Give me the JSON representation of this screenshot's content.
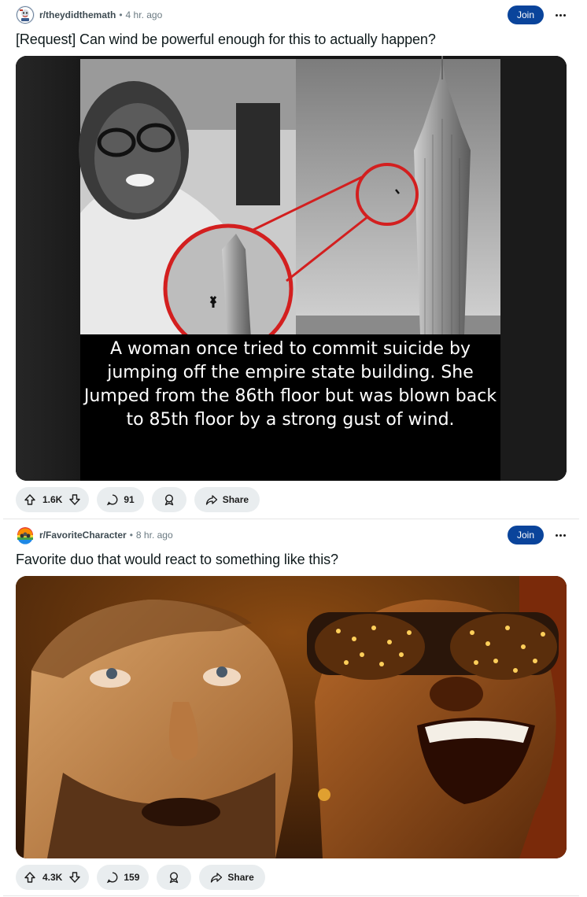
{
  "posts": [
    {
      "subreddit": "r/theydidthemath",
      "separator": "•",
      "time": "4 hr. ago",
      "join_label": "Join",
      "title": "[Request] Can wind be powerful enough for this to actually happen?",
      "image_caption": "A woman once tried to commit suicide by jumping off the empire state building. She Jumped from the 86th floor but was blown back to 85th floor by a strong gust of wind.",
      "votes": "1.6K",
      "comments": "91",
      "share_label": "Share"
    },
    {
      "subreddit": "r/FavoriteCharacter",
      "separator": "•",
      "time": "8 hr. ago",
      "join_label": "Join",
      "title": "Favorite duo that would react to something like this?",
      "votes": "4.3K",
      "comments": "159",
      "share_label": "Share"
    }
  ],
  "icons": {
    "upvote": "arrow-up-icon",
    "downvote": "arrow-down-icon",
    "comment": "speech-bubble-icon",
    "award": "award-icon",
    "share": "share-arrow-icon",
    "more": "ellipsis-icon"
  },
  "colors": {
    "join_button": "#0a449b",
    "pill_background": "#e9edef"
  }
}
